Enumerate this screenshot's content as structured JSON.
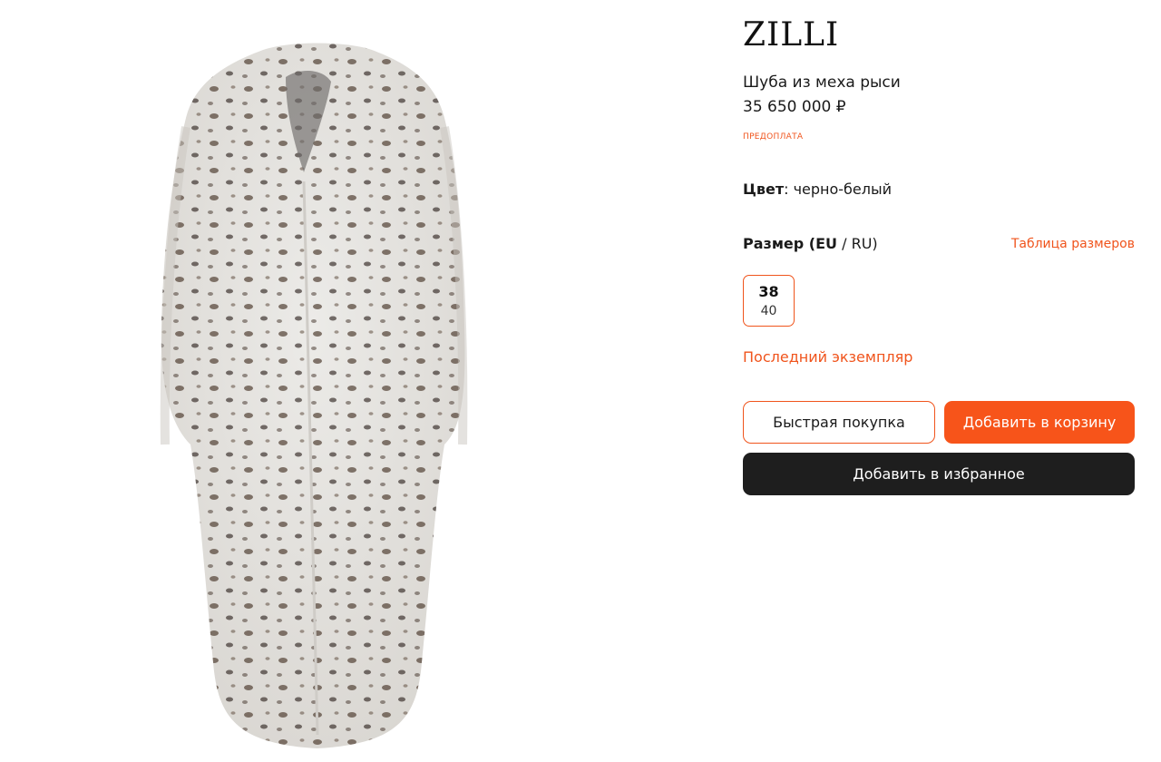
{
  "product": {
    "brand": "ZILLI",
    "title": "Шуба из меха рыси",
    "price": "35 650 000 ₽",
    "prepayment_label": "ПРЕДОПЛАТА",
    "image_alt": "Шуба из меха рыси"
  },
  "color": {
    "label": "Цвет",
    "separator": ":",
    "value": "черно-белый"
  },
  "size": {
    "label_bold": "Размер (EU",
    "label_rest": " / RU)",
    "chart_link": "Таблица размеров",
    "options": [
      {
        "eu": "38",
        "ru": "40",
        "selected": true
      }
    ]
  },
  "stock_note": "Последний экземпляр",
  "actions": {
    "quick_buy": "Быстрая покупка",
    "add_to_cart": "Добавить в корзину",
    "add_to_favorites": "Добавить в избранное"
  },
  "colors": {
    "accent": "#f0541c",
    "button_orange": "#f7541a",
    "button_dark": "#1e1e1e"
  }
}
